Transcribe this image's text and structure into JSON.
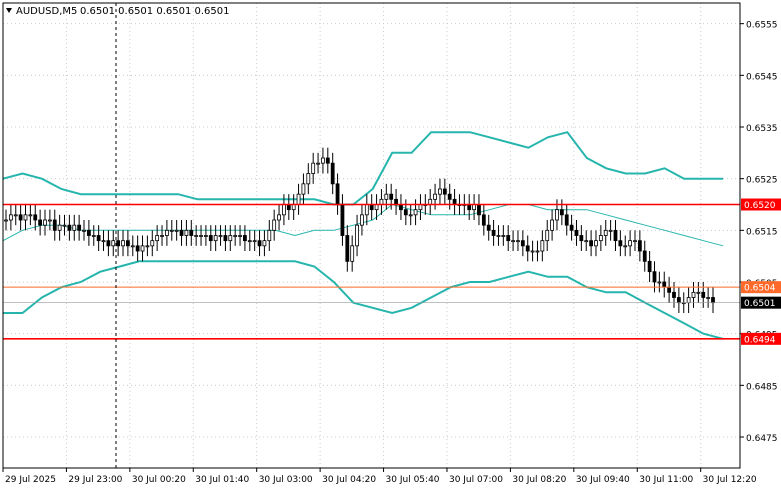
{
  "header": {
    "symbol_title": "AUDUSD,M5",
    "ohlc_text": "0.6501 0.6501 0.6501 0.6501"
  },
  "colors": {
    "grid": "#c8ccd4",
    "candle": "#000000",
    "band": "#26b5ad",
    "level_red": "#ff0000",
    "level_orange": "#ff6a2a",
    "tag_text": "#ffffff",
    "current_tag_bg": "#000000"
  },
  "chart_data": {
    "type": "candlestick",
    "instrument": "AUDUSD",
    "timeframe": "M5",
    "ylim": [
      0.6469,
      0.6559
    ],
    "y_ticks": [
      0.6555,
      0.6545,
      0.6535,
      0.6525,
      0.6515,
      0.6505,
      0.6495,
      0.6485,
      0.6475
    ],
    "y_tick_labels": [
      "0.6555",
      "0.6545",
      "0.6535",
      "0.6525",
      "0.6515",
      "0.6505",
      "0.6495",
      "0.6485",
      "0.6475"
    ],
    "x_tick_labels": [
      "29 Jul 2025",
      "29 Jul 23:00",
      "30 Jul 00:20",
      "30 Jul 01:40",
      "30 Jul 03:00",
      "30 Jul 04:20",
      "30 Jul 05:40",
      "30 Jul 07:00",
      "30 Jul 08:20",
      "30 Jul 09:40",
      "30 Jul 11:00",
      "30 Jul 12:20"
    ],
    "closes": [
      0.6517,
      0.6518,
      0.6518,
      0.6517,
      0.6518,
      0.6518,
      0.6517,
      0.6516,
      0.6517,
      0.6517,
      0.6515,
      0.6516,
      0.6516,
      0.6515,
      0.6516,
      0.6515,
      0.6515,
      0.6514,
      0.6514,
      0.6513,
      0.6513,
      0.6512,
      0.6513,
      0.6512,
      0.6513,
      0.6512,
      0.6512,
      0.6511,
      0.6512,
      0.6512,
      0.6513,
      0.6514,
      0.6514,
      0.6515,
      0.6515,
      0.6515,
      0.6514,
      0.6515,
      0.6514,
      0.6514,
      0.6514,
      0.6514,
      0.6513,
      0.6514,
      0.6514,
      0.6513,
      0.6514,
      0.6514,
      0.6514,
      0.6513,
      0.6513,
      0.6513,
      0.6512,
      0.6513,
      0.6515,
      0.6517,
      0.6518,
      0.652,
      0.6519,
      0.652,
      0.6522,
      0.6524,
      0.6526,
      0.6528,
      0.6528,
      0.6529,
      0.6528,
      0.6524,
      0.652,
      0.6514,
      0.6509,
      0.6512,
      0.6516,
      0.6518,
      0.652,
      0.6519,
      0.652,
      0.6521,
      0.6522,
      0.6521,
      0.652,
      0.6519,
      0.6518,
      0.6518,
      0.6519,
      0.652,
      0.652,
      0.6521,
      0.6522,
      0.6523,
      0.6522,
      0.6521,
      0.652,
      0.652,
      0.652,
      0.6519,
      0.652,
      0.6518,
      0.6516,
      0.6515,
      0.6514,
      0.6514,
      0.6514,
      0.6513,
      0.6513,
      0.6513,
      0.6512,
      0.6511,
      0.6511,
      0.6511,
      0.6513,
      0.6515,
      0.6517,
      0.6519,
      0.6518,
      0.6516,
      0.6515,
      0.6514,
      0.6513,
      0.6513,
      0.6512,
      0.6513,
      0.6514,
      0.6515,
      0.6515,
      0.6513,
      0.6512,
      0.6512,
      0.6513,
      0.6513,
      0.6511,
      0.6509,
      0.6507,
      0.6505,
      0.6505,
      0.6504,
      0.6503,
      0.6502,
      0.6501,
      0.6501,
      0.6502,
      0.6503,
      0.6503,
      0.6502,
      0.6502,
      0.6501
    ],
    "series": [
      {
        "values": [
          0.6525,
          0.6526,
          0.6525,
          0.6523,
          0.6522,
          0.6522,
          0.6522,
          0.6522,
          0.6522,
          0.6522,
          0.6521,
          0.6521,
          0.6521,
          0.6521,
          0.6521,
          0.6521,
          0.6521,
          0.652,
          0.652,
          0.6523,
          0.653,
          0.653,
          0.6534,
          0.6534,
          0.6534,
          0.6533,
          0.6532,
          0.6531,
          0.6533,
          0.6534,
          0.6529,
          0.6527,
          0.6526,
          0.6526,
          0.6527,
          0.6525,
          0.6525,
          0.6525
        ]
      },
      {
        "values": [
          0.6513,
          0.6515,
          0.6516,
          0.6516,
          0.6515,
          0.6515,
          0.6515,
          0.6515,
          0.6515,
          0.6515,
          0.6515,
          0.6515,
          0.6515,
          0.6515,
          0.6515,
          0.6514,
          0.6515,
          0.6515,
          0.6516,
          0.6517,
          0.652,
          0.6519,
          0.6518,
          0.6518,
          0.6518,
          0.6519,
          0.652,
          0.652,
          0.6519,
          0.6519,
          0.6519,
          0.6518,
          0.6517,
          0.6516,
          0.6515,
          0.6514,
          0.6513,
          0.6512
        ]
      },
      {
        "values": [
          0.6499,
          0.6499,
          0.6502,
          0.6504,
          0.6505,
          0.6507,
          0.6508,
          0.6509,
          0.6509,
          0.6509,
          0.6509,
          0.6509,
          0.6509,
          0.6509,
          0.6509,
          0.6509,
          0.6508,
          0.6505,
          0.6501,
          0.65,
          0.6499,
          0.65,
          0.6502,
          0.6504,
          0.6505,
          0.6505,
          0.6506,
          0.6507,
          0.6506,
          0.6506,
          0.6504,
          0.6503,
          0.6503,
          0.6501,
          0.6499,
          0.6497,
          0.6495,
          0.6494
        ]
      }
    ],
    "horizontal_levels": [
      {
        "value": 0.652,
        "label": "0.6520"
      },
      {
        "value": 0.6504,
        "label": "0.6504"
      },
      {
        "value": 0.6494,
        "label": "0.6494"
      }
    ],
    "current_price": {
      "value": 0.6501,
      "label": "0.6501"
    }
  }
}
